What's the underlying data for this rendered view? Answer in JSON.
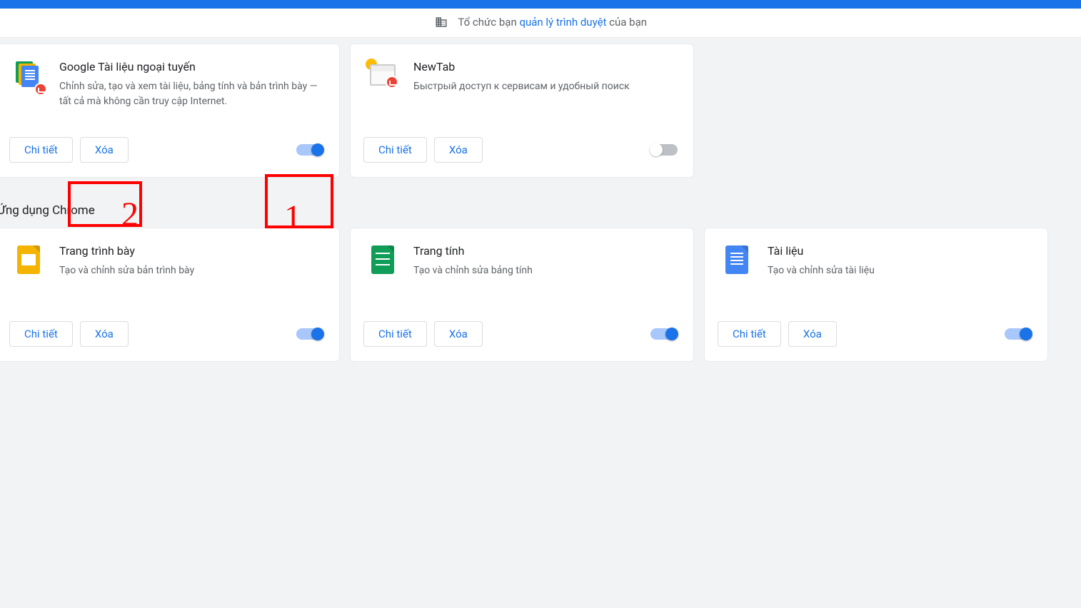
{
  "banner": {
    "prefix": "Tổ chức bạn ",
    "link": "quản lý trình duyệt",
    "suffix": " của bạn"
  },
  "buttons": {
    "details": "Chi tiết",
    "remove": "Xóa"
  },
  "section_apps_title": "Ứng dụng Chrome",
  "annotations": {
    "n1": "1",
    "n2": "2"
  },
  "ext": [
    {
      "title": "Google Tài liệu ngoại tuyến",
      "desc": "Chỉnh sửa, tạo và xem tài liệu, bảng tính và bản trình bày — tất cả mà không cần truy cập Internet.",
      "toggle": true
    },
    {
      "title": "NewTab",
      "desc": "Быстрый доступ к сервисам и удобный поиск",
      "toggle": false
    }
  ],
  "apps": [
    {
      "title": "Trang trình bày",
      "desc": "Tạo và chỉnh sửa bản trình bày",
      "toggle": true
    },
    {
      "title": "Trang tính",
      "desc": "Tạo và chỉnh sửa bảng tính",
      "toggle": true
    },
    {
      "title": "Tài liệu",
      "desc": "Tạo và chỉnh sửa tài liệu",
      "toggle": true
    }
  ]
}
